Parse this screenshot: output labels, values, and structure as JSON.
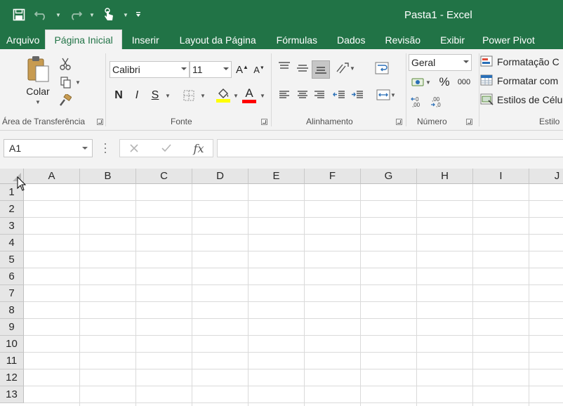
{
  "window": {
    "title": "Pasta1 - Excel"
  },
  "quick_access": {
    "save_icon": "save-icon",
    "undo_icon": "undo-icon",
    "redo_icon": "redo-icon",
    "touch_icon": "touch-mode-icon",
    "customize_icon": "customize-toolbar-icon"
  },
  "tabs": [
    {
      "label": "Arquivo"
    },
    {
      "label": "Página Inicial",
      "active": true
    },
    {
      "label": "Inserir"
    },
    {
      "label": "Layout da Página"
    },
    {
      "label": "Fórmulas"
    },
    {
      "label": "Dados"
    },
    {
      "label": "Revisão"
    },
    {
      "label": "Exibir"
    },
    {
      "label": "Power Pivot"
    }
  ],
  "ribbon": {
    "clipboard": {
      "label": "Área de Transferência",
      "paste_label": "Colar"
    },
    "font": {
      "label": "Fonte",
      "font_name": "Calibri",
      "font_size": "11",
      "bold": "N",
      "italic": "I",
      "underline": "S",
      "fill_color": "#ffff00",
      "font_color": "#ff0000"
    },
    "alignment": {
      "label": "Alinhamento"
    },
    "number": {
      "label": "Número",
      "format": "Geral",
      "percent": "%",
      "thousands": "000"
    },
    "styles": {
      "label": "Estilo",
      "conditional": "Formatação C",
      "format_table": "Formatar com",
      "cell_styles": "Estilos de Célu"
    }
  },
  "formula_bar": {
    "name_box": "A1",
    "fx_label": "fx",
    "formula": ""
  },
  "grid": {
    "columns": [
      "A",
      "B",
      "C",
      "D",
      "E",
      "F",
      "G",
      "H",
      "I",
      "J"
    ],
    "rows": [
      "1",
      "2",
      "3",
      "4",
      "5",
      "6",
      "7",
      "8",
      "9",
      "10",
      "11",
      "12",
      "13"
    ]
  },
  "colors": {
    "accent": "#217346",
    "ribbon_bg": "#f3f3f3",
    "header_bg": "#e6e6e6"
  }
}
